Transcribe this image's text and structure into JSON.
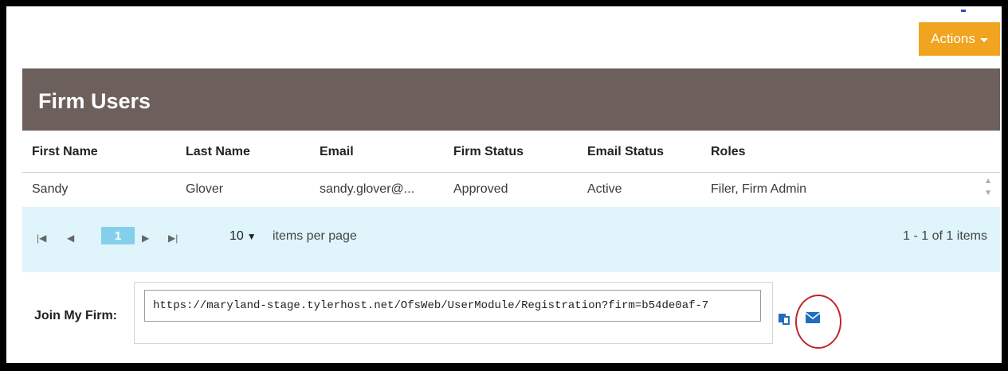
{
  "actions": {
    "label": "Actions"
  },
  "panel": {
    "title": "Firm Users"
  },
  "table": {
    "columns": [
      "First Name",
      "Last Name",
      "Email",
      "Firm Status",
      "Email Status",
      "Roles"
    ],
    "rows": [
      [
        "Sandy",
        "Glover",
        "sandy.glover@...",
        "Approved",
        "Active",
        "Filer, Firm Admin"
      ]
    ]
  },
  "pager": {
    "current_page": "1",
    "page_size": "10",
    "page_size_label": "items per page",
    "summary": "1 - 1 of 1 items"
  },
  "join": {
    "label": "Join My Firm:",
    "url": "https://maryland-stage.tylerhost.net/OfsWeb/UserModule/Registration?firm=b54de0af-7"
  },
  "colors": {
    "accent_actions": "#f0a41f",
    "header_bg": "#6d5f5c",
    "pager_bg": "#dff4fb",
    "page_active": "#84d0ea",
    "highlight_ring": "#c0262c"
  }
}
